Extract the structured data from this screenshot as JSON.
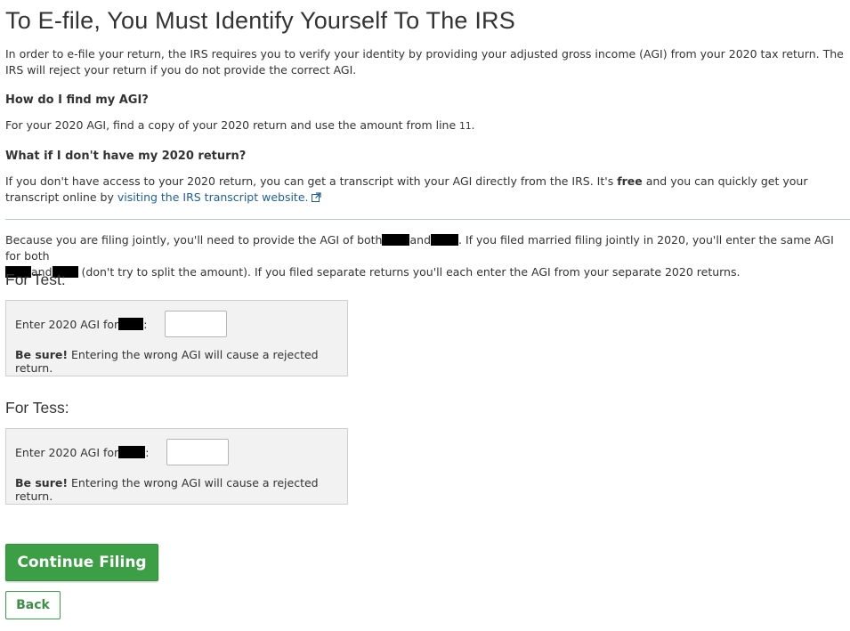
{
  "header": {
    "title": "To E-file, You Must Identify Yourself To The IRS"
  },
  "intro": {
    "text": "In order to e-file your return, the IRS requires you to verify your identity by providing your adjusted gross income (AGI) from your 2020 tax return. The IRS will reject your return if you do not provide the correct AGI."
  },
  "find_agi": {
    "heading": "How do I find my AGI?",
    "text": "For your 2020 AGI, find a copy of your 2020 return and use the amount from line ",
    "line_number": "11",
    "suffix": "."
  },
  "no_return": {
    "heading": "What if I don't have my 2020 return?",
    "text_before": "If you don't have access to your 2020 return, you can get a transcript with your AGI directly from the IRS. It's ",
    "free": "free",
    "text_after": " and you can quickly get your transcript online by ",
    "link_text": "visiting the IRS transcript website.",
    "link_icon": "external-link-icon"
  },
  "joint": {
    "part1": "Because you are filing jointly, you'll need to provide the AGI of both",
    "and1": "and",
    "part2": ". If you filed married filing jointly in 2020, you'll enter the same AGI for both",
    "and2": "and",
    "part3": " (don't try to split the amount). If you filed separate returns you'll each enter the AGI from your separate 2020 returns."
  },
  "persons": [
    {
      "heading": "For Test:",
      "label": "Enter 2020 AGI for",
      "colon": ":",
      "value": "",
      "warning_bold": "Be sure!",
      "warning_text": " Entering the wrong AGI will cause a rejected return."
    },
    {
      "heading": "For Tess:",
      "label": "Enter 2020 AGI for",
      "colon": ":",
      "value": "",
      "warning_bold": "Be sure!",
      "warning_text": " Entering the wrong AGI will cause a rejected return."
    }
  ],
  "buttons": {
    "continue": "Continue Filing",
    "back": "Back"
  },
  "colors": {
    "primary_green": "#3c9f45",
    "link_blue": "#1f5f99",
    "box_bg": "#f2f2f2"
  }
}
